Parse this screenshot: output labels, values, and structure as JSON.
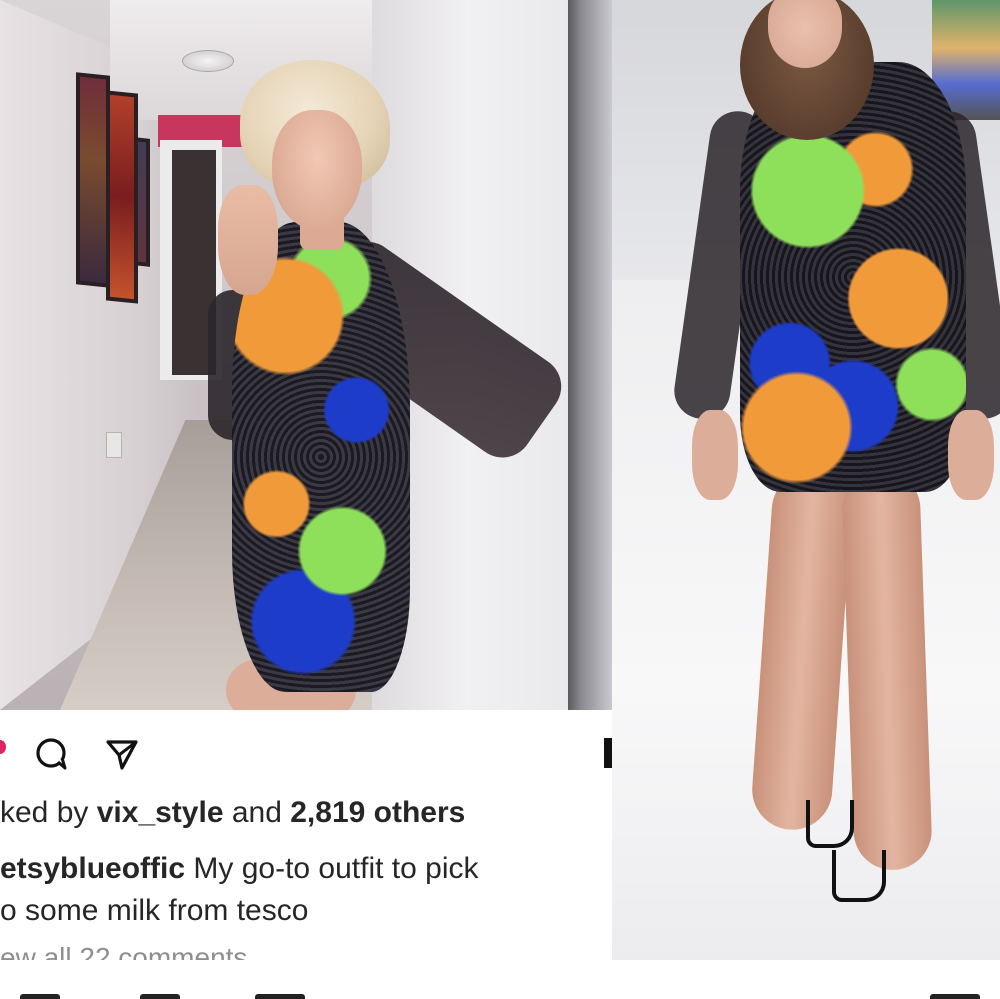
{
  "post": {
    "liked_by_prefix": "ked by ",
    "liked_by_user": "vix_style",
    "liked_by_and": " and ",
    "liked_by_count": "2,819 others",
    "caption_user": "etsyblueoffic",
    "caption_text_1": " My go-to outfit to pick",
    "caption_text_2": "o some milk from tesco",
    "view_comments": "ew all 22 comments"
  },
  "icons": {
    "like": "heart-icon",
    "comment": "comment-icon",
    "share": "share-icon",
    "save": "bookmark-icon"
  },
  "colors": {
    "text": "#262626",
    "muted": "#8e8e8e",
    "like_red": "#e0245e"
  }
}
